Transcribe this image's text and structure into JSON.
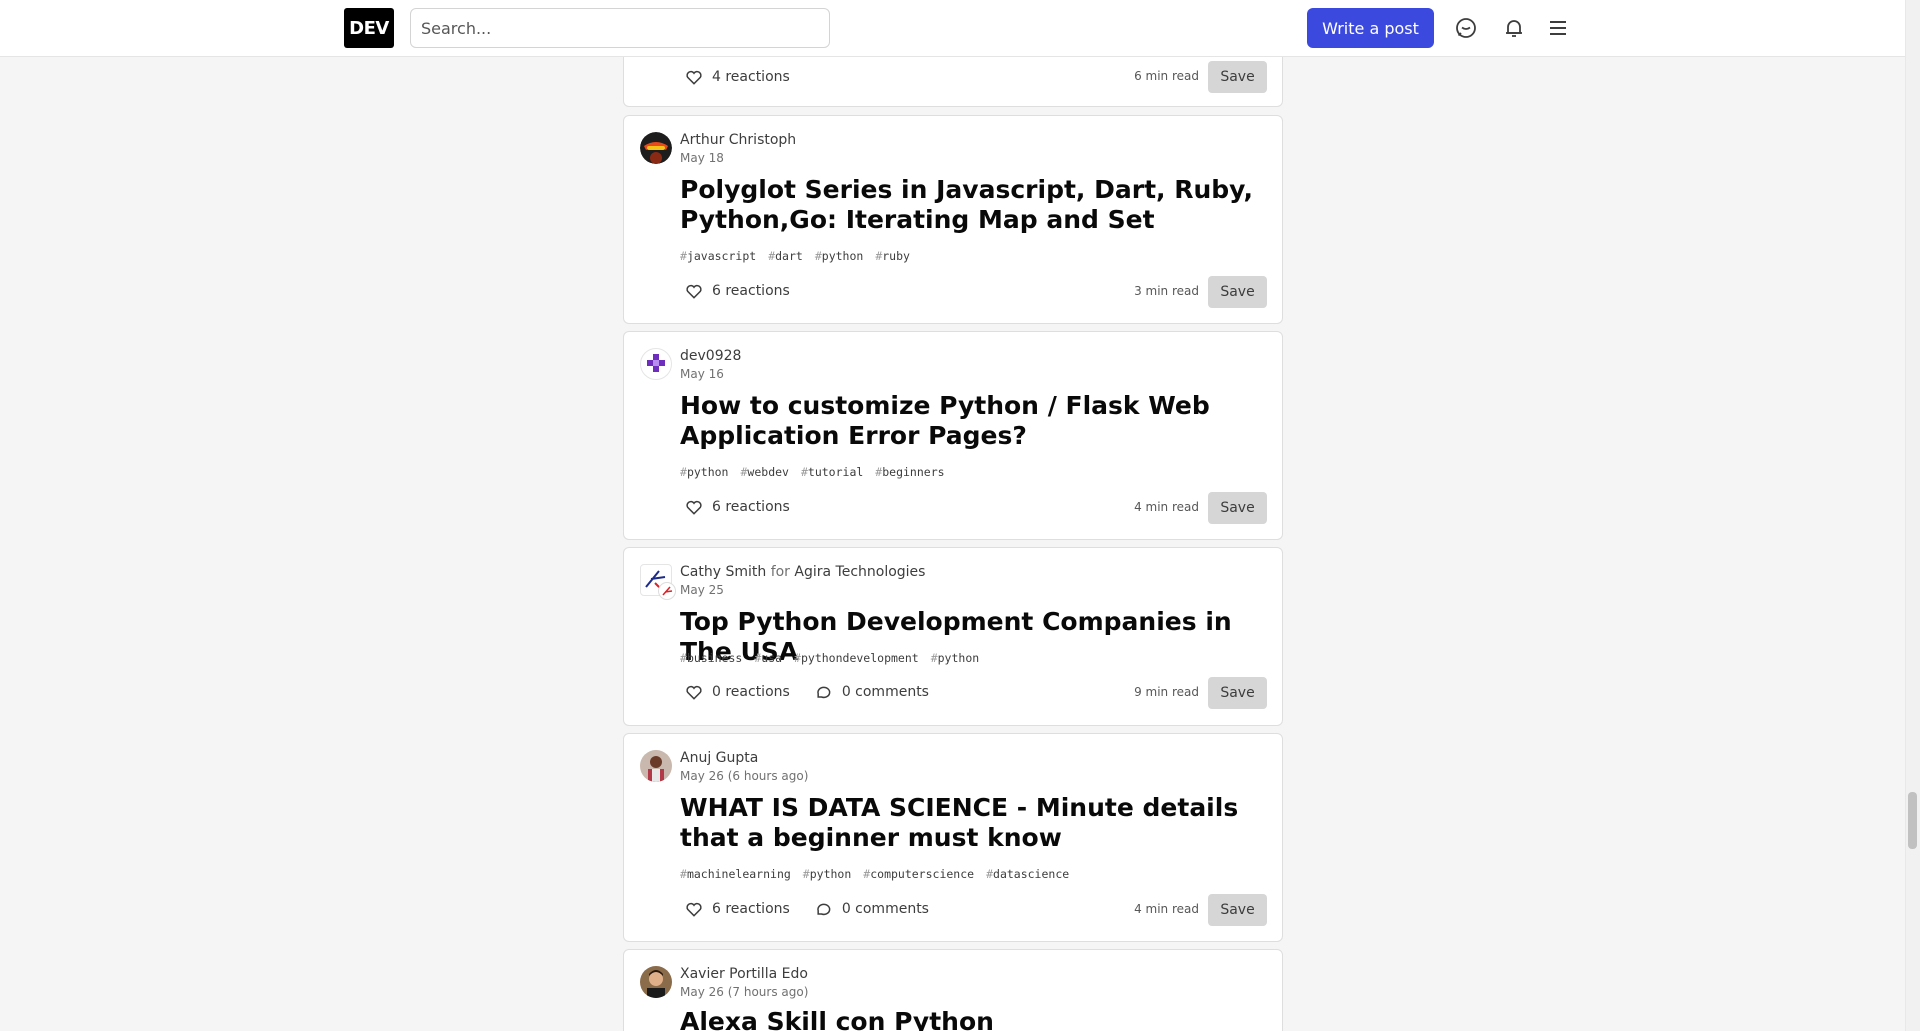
{
  "header": {
    "logo": "DEV",
    "search_placeholder": "Search...",
    "write_post": "Write a post",
    "icons": [
      "chat-icon",
      "bell-icon",
      "menu-icon"
    ]
  },
  "posts": [
    {
      "reactions": "4  reactions",
      "read_time": "6 min read",
      "save": "Save"
    },
    {
      "author": "Arthur Christoph",
      "date": "May 18",
      "title": "Polyglot Series in Javascript, Dart, Ruby, Python,Go: Iterating Map and Set",
      "tags": [
        "javascript",
        "dart",
        "python",
        "ruby"
      ],
      "reactions": "6  reactions",
      "read_time": "3 min read",
      "save": "Save"
    },
    {
      "author": "dev0928",
      "date": "May 16",
      "title": "How to customize Python / Flask Web Application Error Pages?",
      "tags": [
        "python",
        "webdev",
        "tutorial",
        "beginners"
      ],
      "reactions": "6  reactions",
      "read_time": "4 min read",
      "save": "Save"
    },
    {
      "author": "Cathy Smith",
      "for_text": "for",
      "org": "Agira Technologies",
      "date": "May 25",
      "title": "Top Python Development Companies in The USA",
      "tags": [
        "business",
        "usa",
        "pythondevelopment",
        "python"
      ],
      "reactions": "0 reactions",
      "comments": "0 comments",
      "read_time": "9 min read",
      "save": "Save"
    },
    {
      "author": "Anuj Gupta",
      "date": "May 26 (6 hours ago)",
      "title": "WHAT IS DATA SCIENCE - Minute details that a beginner must know",
      "tags": [
        "machinelearning",
        "python",
        "computerscience",
        "datascience"
      ],
      "reactions": "6 reactions",
      "comments": "0 comments",
      "read_time": "4 min read",
      "save": "Save"
    },
    {
      "author": "Xavier Portilla Edo",
      "date": "May 26 (7 hours ago)",
      "title": "Alexa Skill con Python"
    }
  ]
}
